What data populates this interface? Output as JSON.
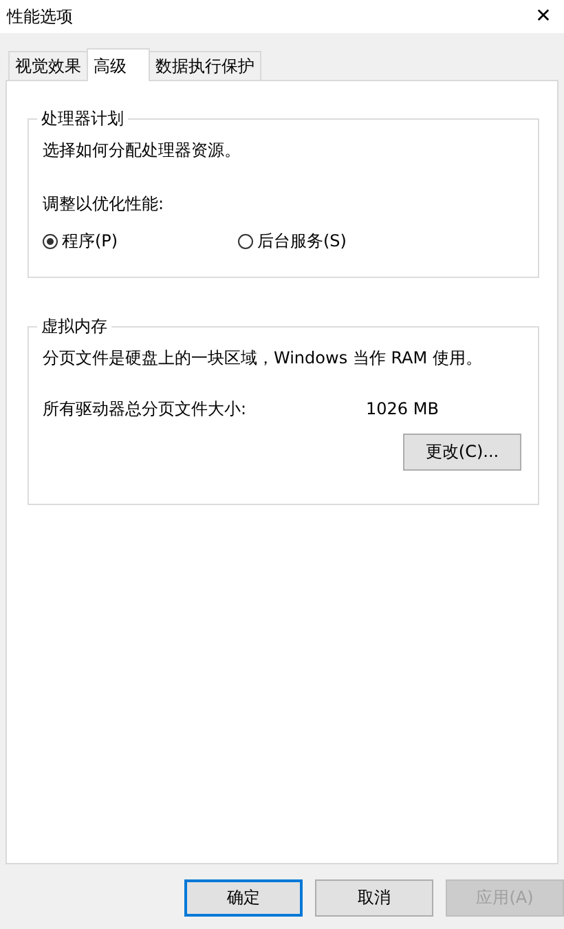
{
  "window": {
    "title": "性能选项",
    "close": "✕"
  },
  "tabs": [
    {
      "label": "视觉效果",
      "selected": false
    },
    {
      "label": "高级",
      "selected": true
    },
    {
      "label": "数据执行保护",
      "selected": false
    }
  ],
  "processor_group": {
    "title": "处理器计划",
    "description": "选择如何分配处理器资源。",
    "adjust_label": "调整以优化性能:",
    "options": [
      {
        "label": "程序(P)",
        "selected": true
      },
      {
        "label": "后台服务(S)",
        "selected": false
      }
    ]
  },
  "virtual_memory_group": {
    "title": "虚拟内存",
    "description": "分页文件是硬盘上的一块区域，Windows 当作 RAM 使用。",
    "total_label": "所有驱动器总分页文件大小:",
    "total_value": "1026 MB",
    "change_button": "更改(C)..."
  },
  "buttons": [
    {
      "label": "确定",
      "default": true,
      "disabled": false
    },
    {
      "label": "取消",
      "default": false,
      "disabled": false
    },
    {
      "label": "应用(A)",
      "default": false,
      "disabled": true
    }
  ]
}
